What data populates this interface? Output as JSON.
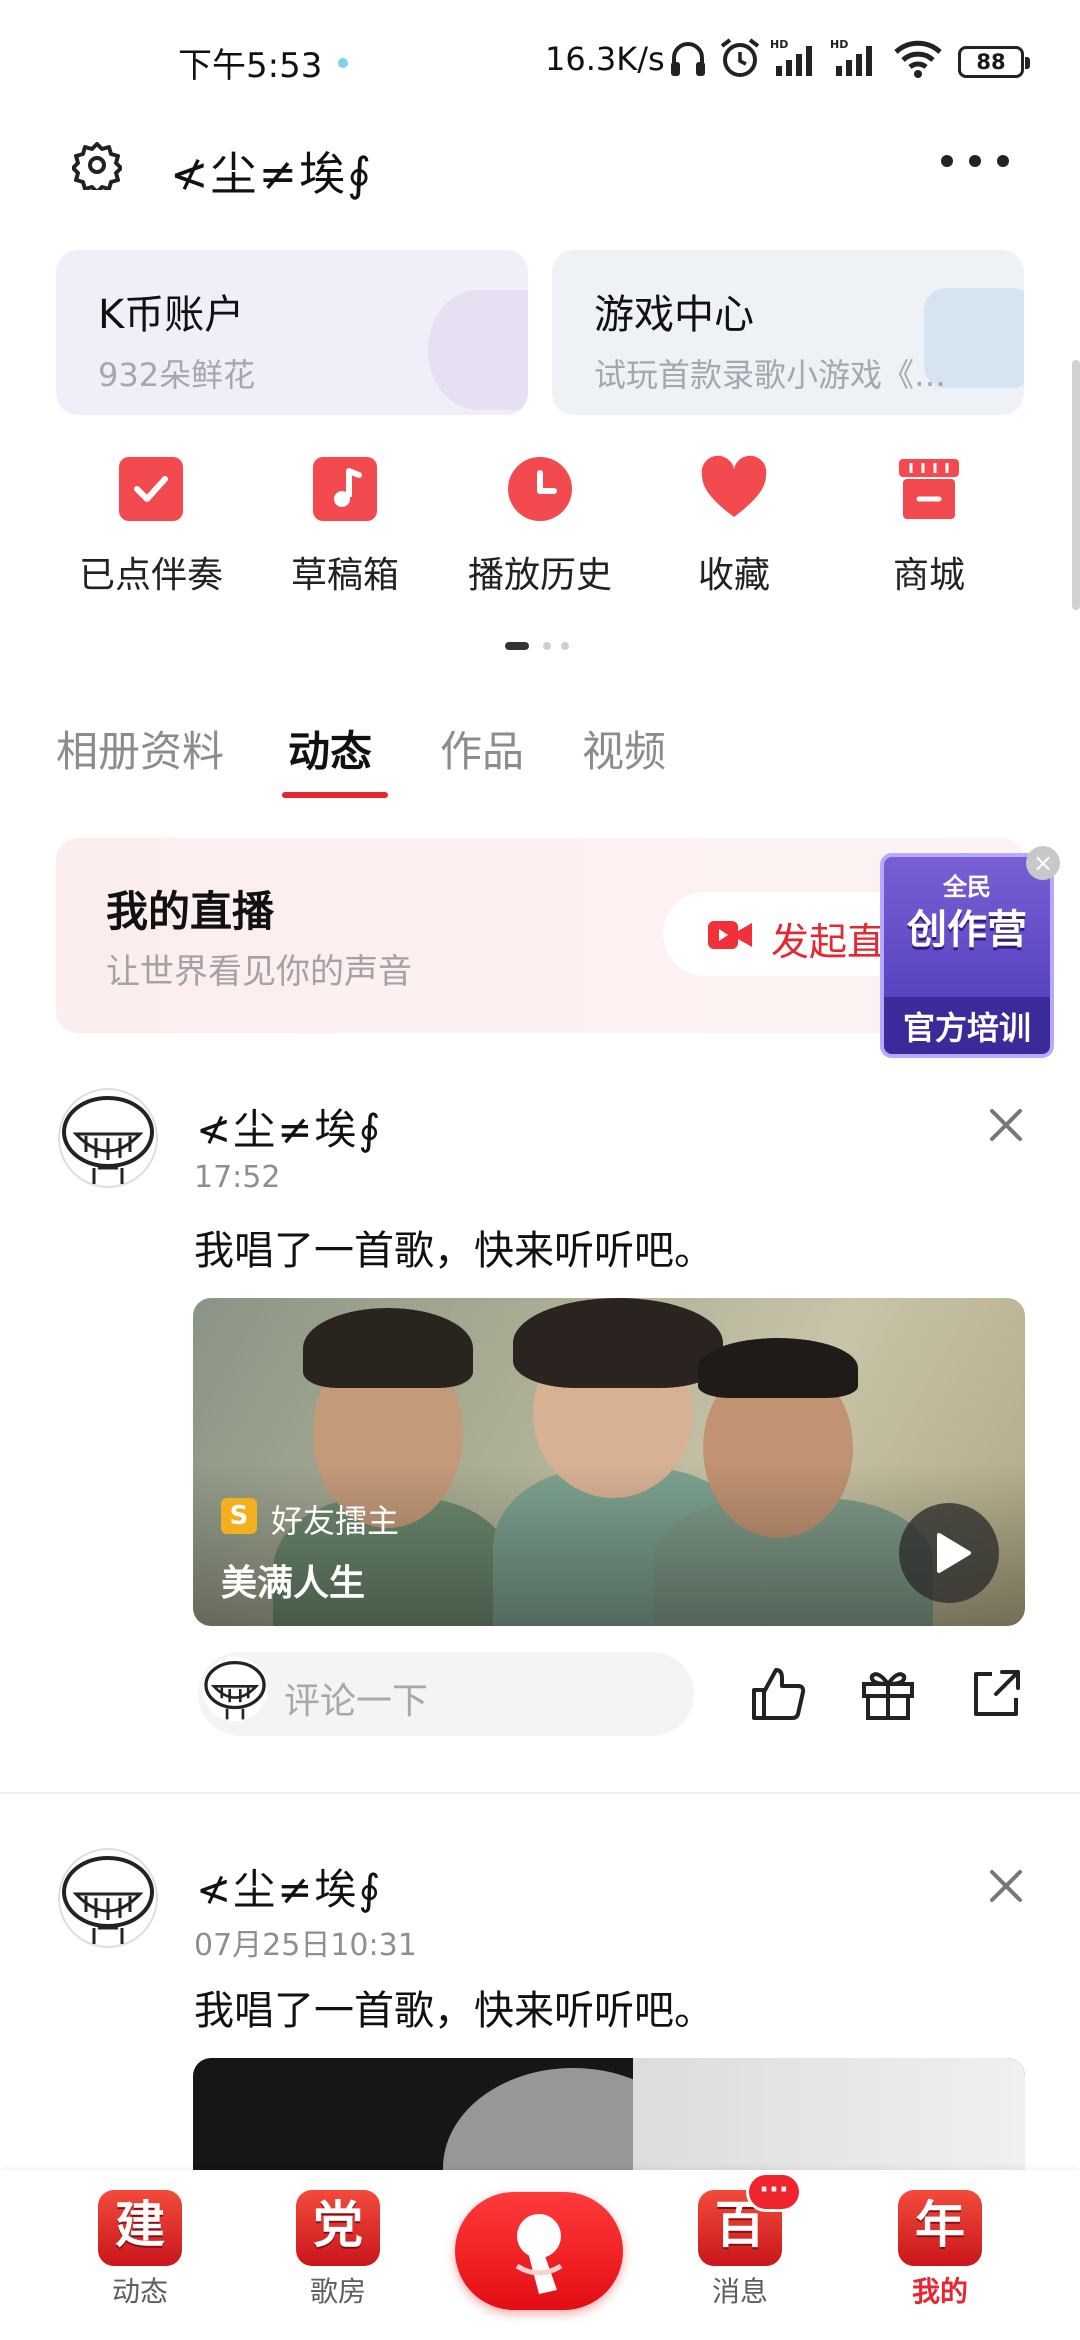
{
  "status_bar": {
    "time": "下午5:53",
    "network_speed": "16.3K/s",
    "battery": "88"
  },
  "header": {
    "username": "≮尘≠埃∮"
  },
  "cards": [
    {
      "title": "K币账户",
      "subtitle": "932朵鲜花"
    },
    {
      "title": "游戏中心",
      "subtitle": "试玩首款录歌小游戏《…"
    }
  ],
  "shortcuts": [
    {
      "label": "已点伴奏",
      "icon": "check-square-icon"
    },
    {
      "label": "草稿箱",
      "icon": "music-note-icon"
    },
    {
      "label": "播放历史",
      "icon": "clock-icon"
    },
    {
      "label": "收藏",
      "icon": "heart-icon"
    },
    {
      "label": "商城",
      "icon": "store-icon"
    }
  ],
  "tabs": [
    {
      "label": "相册资料",
      "active": false
    },
    {
      "label": "动态",
      "active": true
    },
    {
      "label": "作品",
      "active": false
    },
    {
      "label": "视频",
      "active": false
    }
  ],
  "live": {
    "title": "我的直播",
    "subtitle": "让世界看见你的声音",
    "button_label": "发起直播"
  },
  "promo": {
    "top": "全民",
    "main": "创作营",
    "bottom": "官方培训"
  },
  "posts": [
    {
      "author": "≮尘≠埃∮",
      "time": "17:52",
      "text": "我唱了一首歌，快来听听吧。",
      "media_tag": "好友擂主",
      "media_title": "美满人生",
      "comment_placeholder": "评论一下"
    },
    {
      "author": "≮尘≠埃∮",
      "time": "07月25日10:31",
      "text": "我唱了一首歌，快来听听吧。"
    }
  ],
  "bottom_nav": [
    {
      "label": "动态",
      "glyph": "建"
    },
    {
      "label": "歌房",
      "glyph": "党"
    },
    {
      "label": "消息",
      "glyph": "百",
      "badge": "···"
    },
    {
      "label": "我的",
      "glyph": "年",
      "active": true
    }
  ],
  "colors": {
    "accent": "#e8262f",
    "icon_red": "#f24a4e"
  }
}
